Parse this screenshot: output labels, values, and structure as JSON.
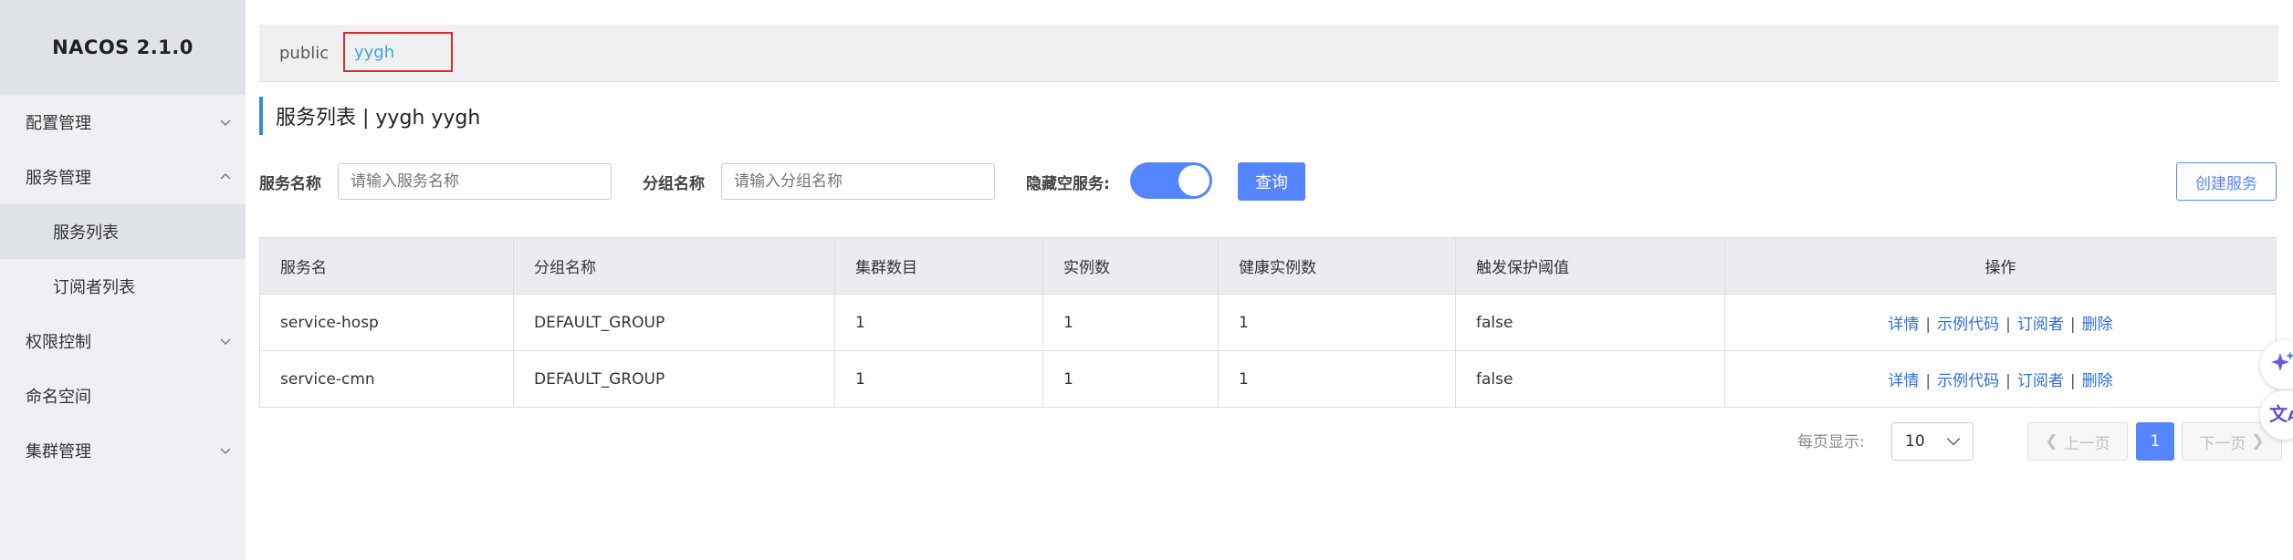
{
  "app": {
    "logo": "NACOS 2.1.0"
  },
  "sidebar": {
    "items": [
      {
        "label": "配置管理",
        "chevron": "down"
      },
      {
        "label": "服务管理",
        "chevron": "up"
      },
      {
        "label": "服务列表",
        "sub": true,
        "active": true
      },
      {
        "label": "订阅者列表",
        "sub": true
      },
      {
        "label": "权限控制",
        "chevron": "down"
      },
      {
        "label": "命名空间"
      },
      {
        "label": "集群管理",
        "chevron": "down"
      }
    ]
  },
  "namespaces": {
    "items": [
      "public",
      "yygh"
    ],
    "active": "yygh"
  },
  "page": {
    "title": "服务列表  |  yygh  yygh"
  },
  "filters": {
    "service_name_label": "服务名称",
    "service_name_placeholder": "请输入服务名称",
    "group_name_label": "分组名称",
    "group_name_placeholder": "请输入分组名称",
    "hide_empty_label": "隐藏空服务:",
    "hide_empty_on": true,
    "query_label": "查询",
    "create_label": "创建服务"
  },
  "table": {
    "headers": [
      "服务名",
      "分组名称",
      "集群数目",
      "实例数",
      "健康实例数",
      "触发保护阈值",
      "操作"
    ],
    "rows": [
      [
        "service-hosp",
        "DEFAULT_GROUP",
        "1",
        "1",
        "1",
        "false"
      ],
      [
        "service-cmn",
        "DEFAULT_GROUP",
        "1",
        "1",
        "1",
        "false"
      ]
    ],
    "actions": [
      "详情",
      "示例代码",
      "订阅者",
      "删除"
    ]
  },
  "pagination": {
    "per_page_label": "每页显示:",
    "per_page_value": "10",
    "prev_label": "上一页",
    "next_label": "下一页",
    "current_page": "1"
  },
  "floating": {
    "icons": [
      "sparkle-icon",
      "translate-icon"
    ]
  },
  "colors": {
    "accent": "#5584ff",
    "link": "#2f6fd6",
    "namespace_active": "#3ca3e4",
    "highlight_border": "#e0252c"
  }
}
